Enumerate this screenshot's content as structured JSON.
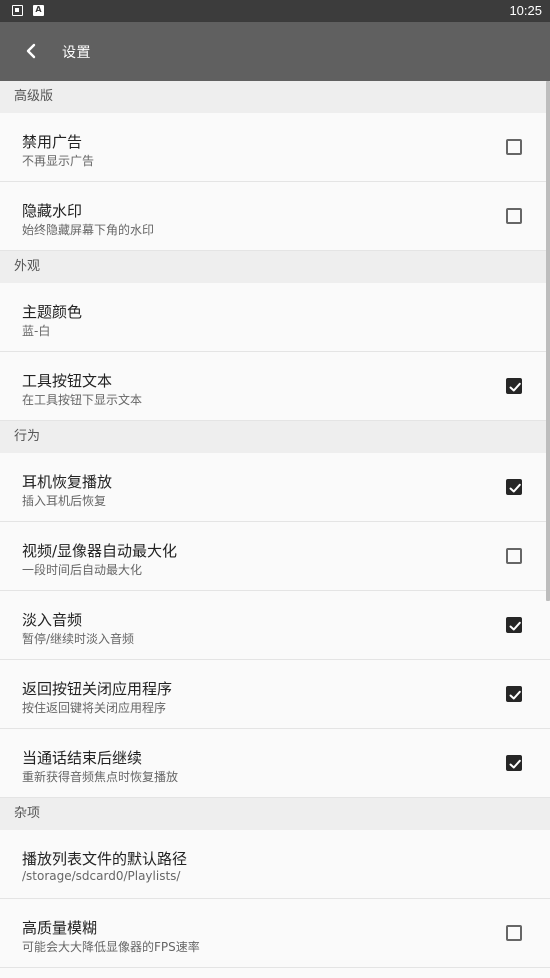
{
  "status_bar": {
    "icons": [
      "screenshot-notify-icon",
      "font-a-icon"
    ],
    "icon_b_label": "A",
    "time": "10:25"
  },
  "toolbar": {
    "title": "设置"
  },
  "sections": [
    {
      "header": "高级版",
      "items": [
        {
          "title": "禁用广告",
          "summary": "不再显示广告",
          "checkbox": true,
          "checked": false
        },
        {
          "title": "隐藏水印",
          "summary": "始终隐藏屏幕下角的水印",
          "checkbox": true,
          "checked": false
        }
      ]
    },
    {
      "header": "外观",
      "items": [
        {
          "title": "主题颜色",
          "summary": "蓝-白",
          "checkbox": false
        },
        {
          "title": "工具按钮文本",
          "summary": "在工具按钮下显示文本",
          "checkbox": true,
          "checked": true
        }
      ]
    },
    {
      "header": "行为",
      "items": [
        {
          "title": "耳机恢复播放",
          "summary": "插入耳机后恢复",
          "checkbox": true,
          "checked": true
        },
        {
          "title": "视频/显像器自动最大化",
          "summary": "一段时间后自动最大化",
          "checkbox": true,
          "checked": false
        },
        {
          "title": "淡入音频",
          "summary": "暂停/继续时淡入音频",
          "checkbox": true,
          "checked": true
        },
        {
          "title": "返回按钮关闭应用程序",
          "summary": "按住返回键将关闭应用程序",
          "checkbox": true,
          "checked": true
        },
        {
          "title": "当通话结束后继续",
          "summary": "重新获得音频焦点时恢复播放",
          "checkbox": true,
          "checked": true
        }
      ]
    },
    {
      "header": "杂项",
      "items": [
        {
          "title": "播放列表文件的默认路径",
          "summary": "/storage/sdcard0/Playlists/",
          "checkbox": false
        },
        {
          "title": "高质量模糊",
          "summary": "可能会大大降低显像器的FPS速率",
          "checkbox": true,
          "checked": false
        }
      ]
    }
  ]
}
